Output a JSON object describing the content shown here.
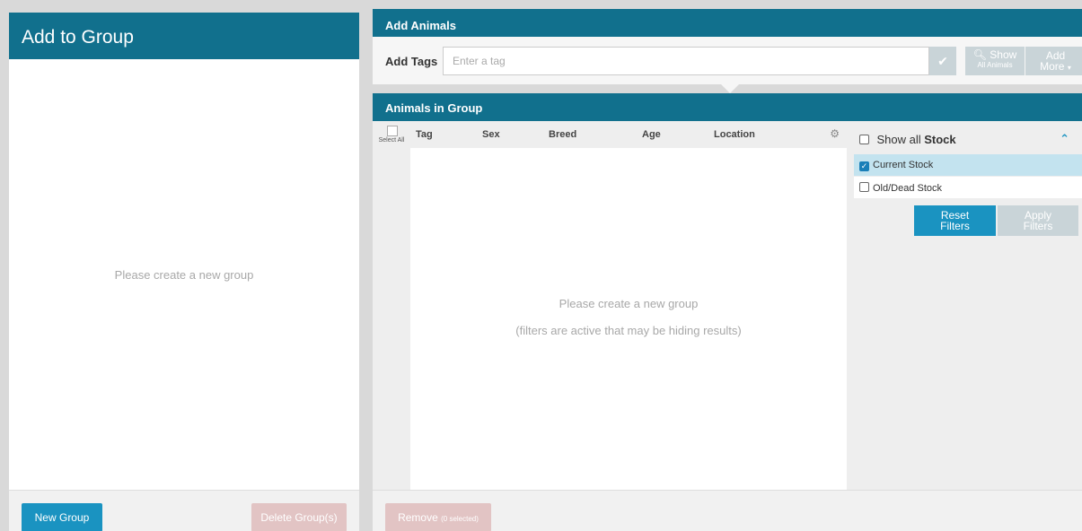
{
  "left_panel": {
    "title": "Add to Group",
    "empty_message": "Please create a new group",
    "new_group_label": "New Group",
    "delete_group_label": "Delete Group(s)"
  },
  "add_animals": {
    "title": "Add Animals",
    "tags_label": "Add Tags",
    "tag_placeholder": "Enter a tag",
    "show_label": "Show",
    "show_sub_label": "All Animals",
    "add_more_label_1": "Add",
    "add_more_label_2": "More"
  },
  "animals_in_group": {
    "title": "Animals in Group",
    "select_all_label": "Select All",
    "columns": [
      "Tag",
      "Sex",
      "Breed",
      "Age",
      "Location"
    ],
    "empty_message": "Please create a new group",
    "filter_notice": "(filters are active that may be hiding results)",
    "remove_label": "Remove",
    "remove_count": "(0 selected)"
  },
  "filters": {
    "show_all_prefix": "Show all",
    "show_all_bold": "Stock",
    "current_stock_label": "Current Stock",
    "current_stock_checked": true,
    "old_dead_stock_label": "Old/Dead Stock",
    "old_dead_stock_checked": false,
    "reset_label_1": "Reset",
    "reset_label_2": "Filters",
    "apply_label_1": "Apply",
    "apply_label_2": "Filters"
  },
  "colors": {
    "header": "#11708d",
    "primary_button": "#1a93c1",
    "disabled_danger": "#e2c4c4",
    "disabled_button": "#c9d4d8",
    "selected_row": "#c3e3ef"
  }
}
